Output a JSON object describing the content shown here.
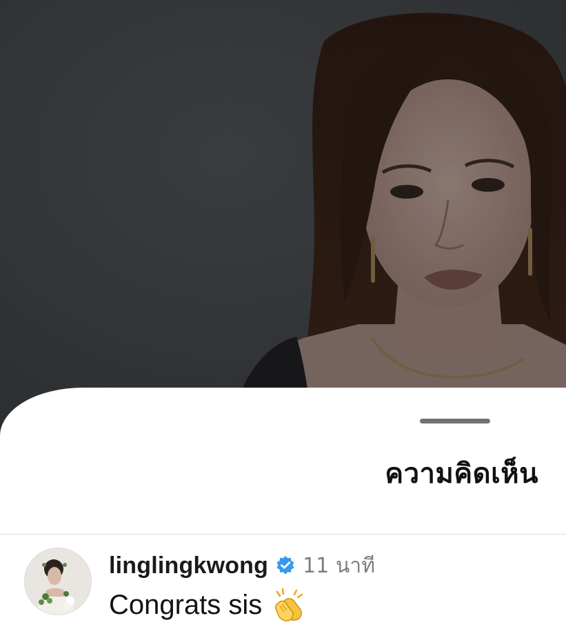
{
  "sheet": {
    "title": "ความคิดเห็น"
  },
  "comments": [
    {
      "username": "linglingkwong",
      "verified": true,
      "time": "11 นาที",
      "text": "Congrats sis",
      "emoji_icon": "clapping-hands-icon",
      "avatar_icon": "user-avatar"
    }
  ],
  "colors": {
    "backdrop": "#3c3f43",
    "verified_badge": "#3897f0",
    "timestamp": "#7b7f84",
    "grabber": "#6f7378"
  }
}
